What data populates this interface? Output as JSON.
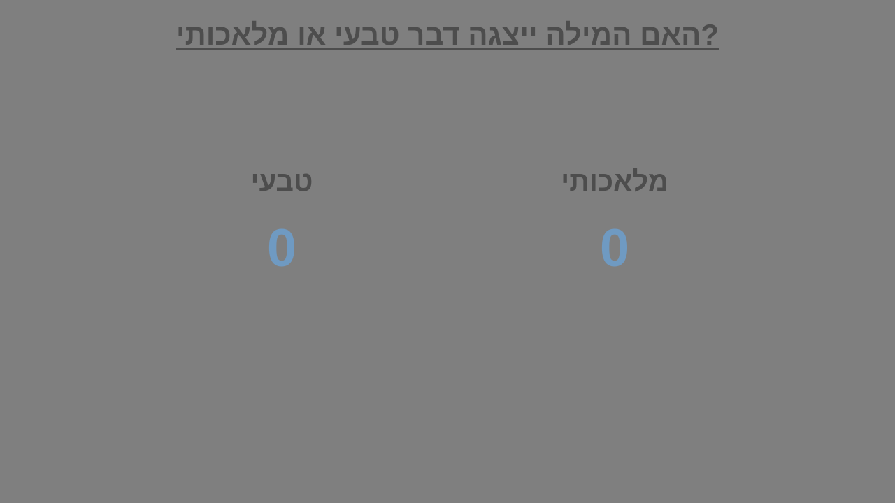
{
  "question": "?האם המילה ייצגה דבר טבעי או מלאכותי",
  "columns": {
    "natural": {
      "title": "טבעי",
      "score": "0"
    },
    "artificial": {
      "title": "מלאכותי",
      "score": "0"
    }
  },
  "colors": {
    "background": "#7f7f7f",
    "text": "#4d4d4d",
    "score": "#6f9ac2"
  }
}
